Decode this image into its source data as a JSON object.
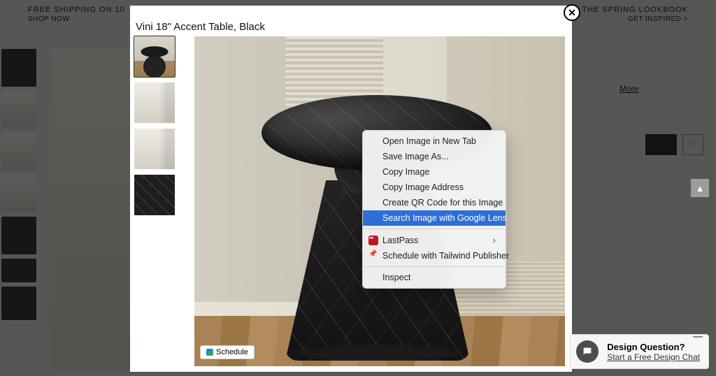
{
  "promo": {
    "left_line1": "FREE SHIPPING ON 10",
    "left_line2": "SHOP NOW",
    "right_line1": "ED: THE SPRING LOOKBOOK",
    "right_line2": "GET INSPIRED >"
  },
  "bg": {
    "more": "More"
  },
  "modal": {
    "title": "Vini 18\" Accent Table, Black",
    "schedule_label": "Schedule"
  },
  "context_menu": {
    "items": [
      {
        "label": "Open Image in New Tab"
      },
      {
        "label": "Save Image As..."
      },
      {
        "label": "Copy Image"
      },
      {
        "label": "Copy Image Address"
      },
      {
        "label": "Create QR Code for this Image"
      },
      {
        "label": "Search Image with Google Lens",
        "highlighted": true
      }
    ],
    "ext": [
      {
        "label": "LastPass",
        "submenu": true
      },
      {
        "label": "Schedule with Tailwind Publisher"
      }
    ],
    "inspect": "Inspect"
  },
  "chat": {
    "title": "Design Question?",
    "link": "Start a Free Design Chat"
  },
  "icons": {
    "heart": "♡",
    "chevron_up": "▲",
    "chevron_right": "›",
    "close": "✕"
  }
}
